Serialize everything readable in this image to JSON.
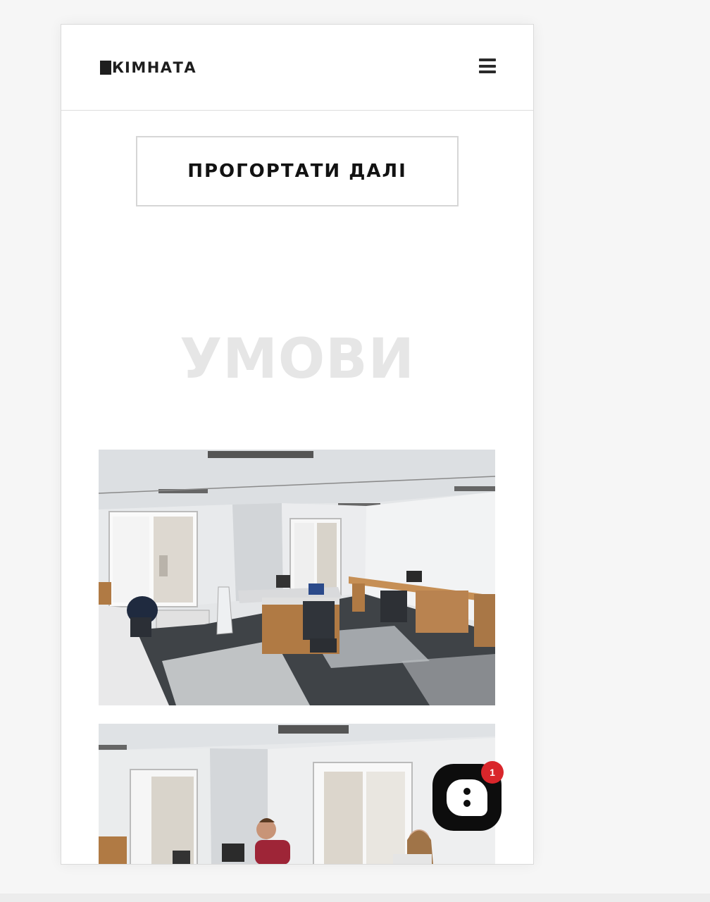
{
  "header": {
    "logo_k": "К",
    "logo_text": "IМНАТА",
    "menu_icon": "hamburger-menu-icon"
  },
  "main": {
    "scroll_button_label": "ПРОГОРТАТИ ДАЛІ",
    "section_title": "УМОВИ"
  },
  "gallery": {
    "photos": [
      "office-room-photo",
      "office-room-people-photo"
    ]
  },
  "chat": {
    "icon": "chat-bubble-icon",
    "badge_count": "1"
  },
  "colors": {
    "text": "#121212",
    "section_title": "#e6e6e6",
    "badge": "#d9262b",
    "border": "#d6d6d6"
  }
}
